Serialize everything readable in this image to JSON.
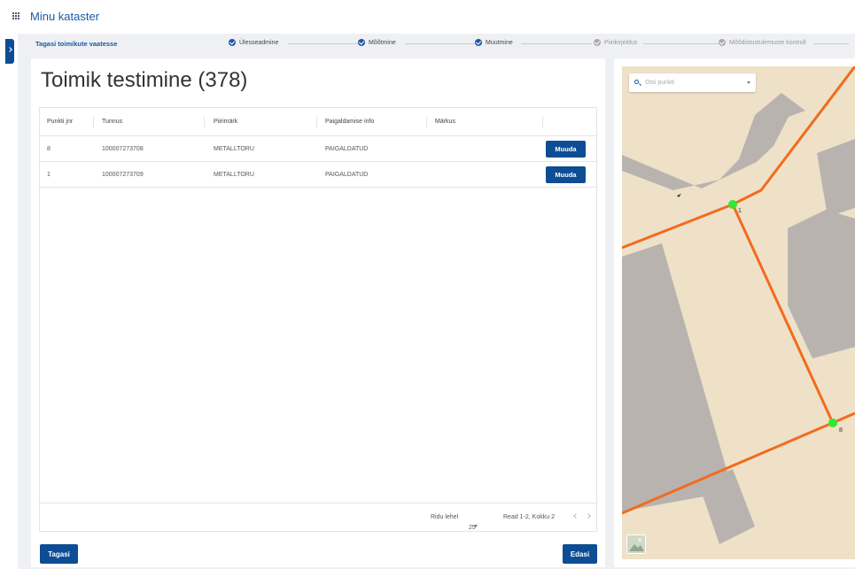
{
  "app": {
    "title": "Minu kataster"
  },
  "stepper": {
    "back_label": "Tagasi toimikute vaatesse",
    "steps": [
      {
        "label": "Ülesseadmine",
        "state": "done"
      },
      {
        "label": "Mõõtmine",
        "state": "done"
      },
      {
        "label": "Muutmine",
        "state": "active"
      },
      {
        "label": "Piirikirjeldus",
        "state": "pending"
      },
      {
        "label": "Mõõdistustulemuste kontroll",
        "state": "pending"
      }
    ]
  },
  "main": {
    "title": "Toimik testimine (378)",
    "table": {
      "columns": [
        "Punkti jnr",
        "Tunnus",
        "Piirimärk",
        "Paigaldamise info",
        "Märkus"
      ],
      "rows": [
        {
          "jnr": "8",
          "tunnus": "100007273708",
          "piirimark": "METALLTORU",
          "info": "PAIGALDATUD",
          "markus": "",
          "action": "Muuda"
        },
        {
          "jnr": "1",
          "tunnus": "100007273709",
          "piirimark": "METALLTORU",
          "info": "PAIGALDATUD",
          "markus": "",
          "action": "Muuda"
        }
      ]
    },
    "footer": {
      "rows_per_page_label": "Ridu lehel",
      "rows_per_page_value": "25",
      "range_text": "Read 1-2, Kokku 2"
    },
    "back_button": "Tagasi",
    "next_button": "Edasi"
  },
  "map": {
    "search_placeholder": "Otsi punkti",
    "points": [
      {
        "label": "1"
      },
      {
        "label": "8"
      }
    ],
    "colors": {
      "background": "#eee1c8",
      "building": "#b9b3b0",
      "boundary": "#f26b1d",
      "point": "#33e633"
    }
  },
  "colors": {
    "primary": "#0d4d93",
    "link": "#1a5aa6",
    "content_bg": "#eef0f3"
  }
}
